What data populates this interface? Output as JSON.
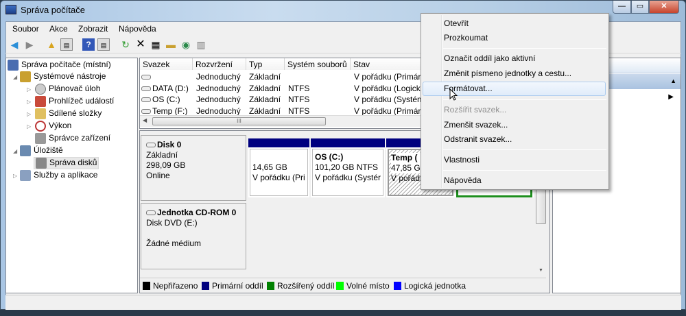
{
  "window": {
    "title": "Správa počítače",
    "minimize": "—",
    "maximize": "▭",
    "close": "✕"
  },
  "menu": [
    "Soubor",
    "Akce",
    "Zobrazit",
    "Nápověda"
  ],
  "toolbar": [
    "back-icon",
    "forward-icon",
    "up-icon",
    "show-hide-tree-icon",
    "help-icon",
    "show-hide-action-icon",
    "refresh-icon",
    "delete-icon",
    "properties-icon",
    "open-icon",
    "search-icon",
    "settings-icon"
  ],
  "tree": {
    "root": "Správa počítače (místní)",
    "system_tools": "Systémové nástroje",
    "task_scheduler": "Plánovač úloh",
    "event_viewer": "Prohlížeč událostí",
    "shared_folders": "Sdílené složky",
    "performance": "Výkon",
    "device_manager": "Správce zařízení",
    "storage": "Úložiště",
    "disk_management": "Správa disků",
    "services": "Služby a aplikace"
  },
  "volumes": {
    "columns": [
      "Svazek",
      "Rozvržení",
      "Typ",
      "Systém souborů",
      "Stav"
    ],
    "rows": [
      [
        "",
        "Jednoduchý",
        "Základní",
        "",
        "V pořádku (Primár"
      ],
      [
        "DATA (D:)",
        "Jednoduchý",
        "Základní",
        "NTFS",
        "V pořádku (Logick"
      ],
      [
        "OS (C:)",
        "Jednoduchý",
        "Základní",
        "NTFS",
        "V pořádku (Systém"
      ],
      [
        "Temp (F:)",
        "Jednoduchý",
        "Základní",
        "NTFS",
        "V pořádku (Primár"
      ]
    ],
    "scroll_grip": "III"
  },
  "disk0": {
    "name": "Disk 0",
    "type": "Základní",
    "size": "298,09 GB",
    "status": "Online",
    "partitions": [
      {
        "title": "",
        "size": "14,65 GB",
        "status": "V pořádku (Pri"
      },
      {
        "title": "OS  (C:)",
        "size": "101,20 GB NTFS",
        "status": "V pořádku (Systér"
      },
      {
        "title": "Temp  (",
        "size": "47,85 GB",
        "status": "V pořádk"
      }
    ]
  },
  "cdrom": {
    "name": "Jednotka CD-ROM 0",
    "type": "Disk DVD (E:)",
    "status": "Žádné médium"
  },
  "legend": [
    {
      "label": "Nepřiřazeno",
      "color": "#000000"
    },
    {
      "label": "Primární oddíl",
      "color": "#00007f"
    },
    {
      "label": "Rozšířený oddíl",
      "color": "#008000"
    },
    {
      "label": "Volné místo",
      "color": "#00ff00"
    },
    {
      "label": "Logická jednotka",
      "color": "#0000ff"
    }
  ],
  "context_menu": {
    "open": "Otevřít",
    "explore": "Prozkoumat",
    "mark_active": "Označit oddíl jako aktivní",
    "change_letter": "Změnit písmeno jednotky a cestu...",
    "format": "Formátovat...",
    "extend": "Rozšířit svazek...",
    "shrink": "Zmenšit svazek...",
    "delete": "Odstranit svazek...",
    "properties": "Vlastnosti",
    "help": "Nápověda"
  }
}
